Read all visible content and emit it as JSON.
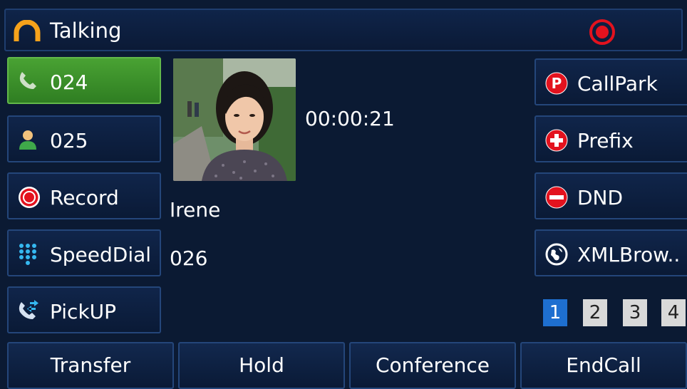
{
  "status": {
    "title": "Talking"
  },
  "line_keys_left": [
    {
      "label": "024",
      "icon": "handset-icon",
      "active": true
    },
    {
      "label": "025",
      "icon": "contact-icon",
      "active": false
    },
    {
      "label": "Record",
      "icon": "record-icon",
      "active": false
    },
    {
      "label": "SpeedDial",
      "icon": "keypad-icon",
      "active": false
    },
    {
      "label": "PickUP",
      "icon": "pickup-icon",
      "active": false
    }
  ],
  "call": {
    "duration": "00:00:21",
    "name": "Irene",
    "number": "026"
  },
  "line_keys_right": [
    {
      "label": "CallPark",
      "icon": "park-icon"
    },
    {
      "label": "Prefix",
      "icon": "plus-circle-icon"
    },
    {
      "label": "DND",
      "icon": "dnd-icon"
    },
    {
      "label": "XMLBrow..",
      "icon": "globe-icon"
    }
  ],
  "pages": {
    "items": [
      "1",
      "2",
      "3",
      "4"
    ],
    "current": "1"
  },
  "softkeys": {
    "transfer": "Transfer",
    "hold": "Hold",
    "conference": "Conference",
    "endcall": "EndCall"
  },
  "colors": {
    "background": "#0b1a33",
    "active_line": "#3f9a2c",
    "record_red": "#e3121e",
    "page_active": "#1e6fd0"
  }
}
